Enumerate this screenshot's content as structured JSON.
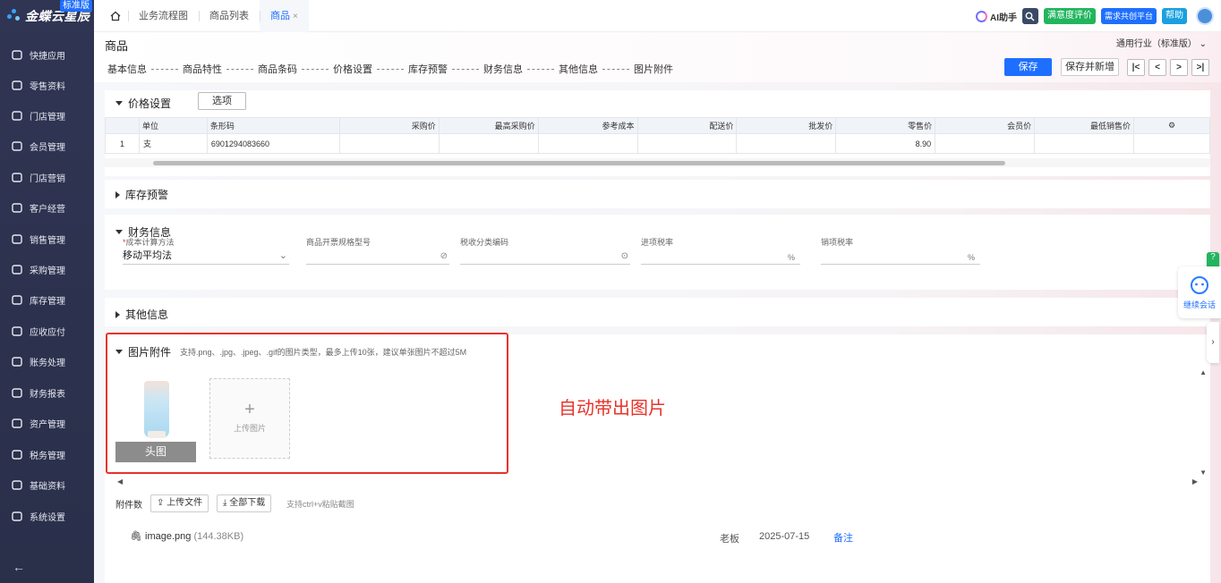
{
  "app": {
    "logo_text": "金蝶云星辰",
    "logo_badge": "标准版"
  },
  "sidebar": {
    "items": [
      {
        "label": "快捷应用",
        "icon": "grid-icon"
      },
      {
        "label": "零售资料",
        "icon": "basket-icon"
      },
      {
        "label": "门店管理",
        "icon": "store-icon"
      },
      {
        "label": "会员管理",
        "icon": "diamond-icon"
      },
      {
        "label": "门店营销",
        "icon": "tag-icon"
      },
      {
        "label": "客户经营",
        "icon": "user-icon"
      },
      {
        "label": "销售管理",
        "icon": "chart-icon"
      },
      {
        "label": "采购管理",
        "icon": "cart-icon"
      },
      {
        "label": "库存管理",
        "icon": "box-icon"
      },
      {
        "label": "应收应付",
        "icon": "coin-icon"
      },
      {
        "label": "账务处理",
        "icon": "ledger-icon"
      },
      {
        "label": "财务报表",
        "icon": "report-icon"
      },
      {
        "label": "资产管理",
        "icon": "asset-icon"
      },
      {
        "label": "税务管理",
        "icon": "tax-icon"
      },
      {
        "label": "基础资料",
        "icon": "layers-icon"
      },
      {
        "label": "系统设置",
        "icon": "gear-icon"
      }
    ],
    "back": "←"
  },
  "topbar": {
    "tabs": [
      {
        "label": "业务流程图"
      },
      {
        "label": "商品列表"
      },
      {
        "label": "商品",
        "close": "×"
      }
    ],
    "ai_label": "AI助手",
    "feedback_label": "满意度评价",
    "platform_label": "需求共创平台",
    "help_label": "帮助"
  },
  "page": {
    "title": "商品",
    "industry": "通用行业（标准版）",
    "steps": [
      "基本信息",
      "商品特性",
      "商品条码",
      "价格设置",
      "库存预警",
      "财务信息",
      "其他信息",
      "图片附件"
    ],
    "save_label": "保存",
    "save_new_label": "保存并新增",
    "nav": [
      "|<",
      "<",
      ">",
      ">|"
    ]
  },
  "price_section": {
    "title": "价格设置",
    "options_label": "选项",
    "columns": [
      "单位",
      "条形码",
      "采购价",
      "最高采购价",
      "参考成本",
      "配送价",
      "批发价",
      "零售价",
      "会员价",
      "最低销售价"
    ],
    "rows": [
      {
        "index": "1",
        "unit": "支",
        "barcode": "6901294083660",
        "retail": "8.90"
      }
    ]
  },
  "stock_section": {
    "title": "库存预警"
  },
  "finance_section": {
    "title": "财务信息",
    "fields": [
      {
        "label": "成本计算方法",
        "value": "移动平均法"
      },
      {
        "label": "商品开票规格型号",
        "value": ""
      },
      {
        "label": "税收分类编码",
        "value": ""
      },
      {
        "label": "进项税率",
        "value": "%"
      },
      {
        "label": "销项税率",
        "value": "%"
      }
    ]
  },
  "other_section": {
    "title": "其他信息"
  },
  "image_section": {
    "title": "图片附件",
    "hint": "支持.png、.jpg、.jpeg、.gif的图片类型，最多上传10张，建议单张图片不超过5M",
    "main_image_label": "头图",
    "upload_label": "上传图片",
    "annotation": "自动带出图片"
  },
  "attachments": {
    "label": "附件数",
    "upload_label": "上传文件",
    "download_label": "全部下载",
    "paste_hint": "支持ctrl+v粘贴截图",
    "file_name": "image.png",
    "file_size": "(144.38KB)",
    "uploader": "老板",
    "date": "2025-07-15",
    "note_label": "备注"
  },
  "float_widget": {
    "continue_label": "继续会话"
  },
  "colors": {
    "primary": "#1e6fff",
    "sidebar_bg": "#2f3553",
    "annotation": "#e8332a",
    "green": "#22b55e"
  }
}
